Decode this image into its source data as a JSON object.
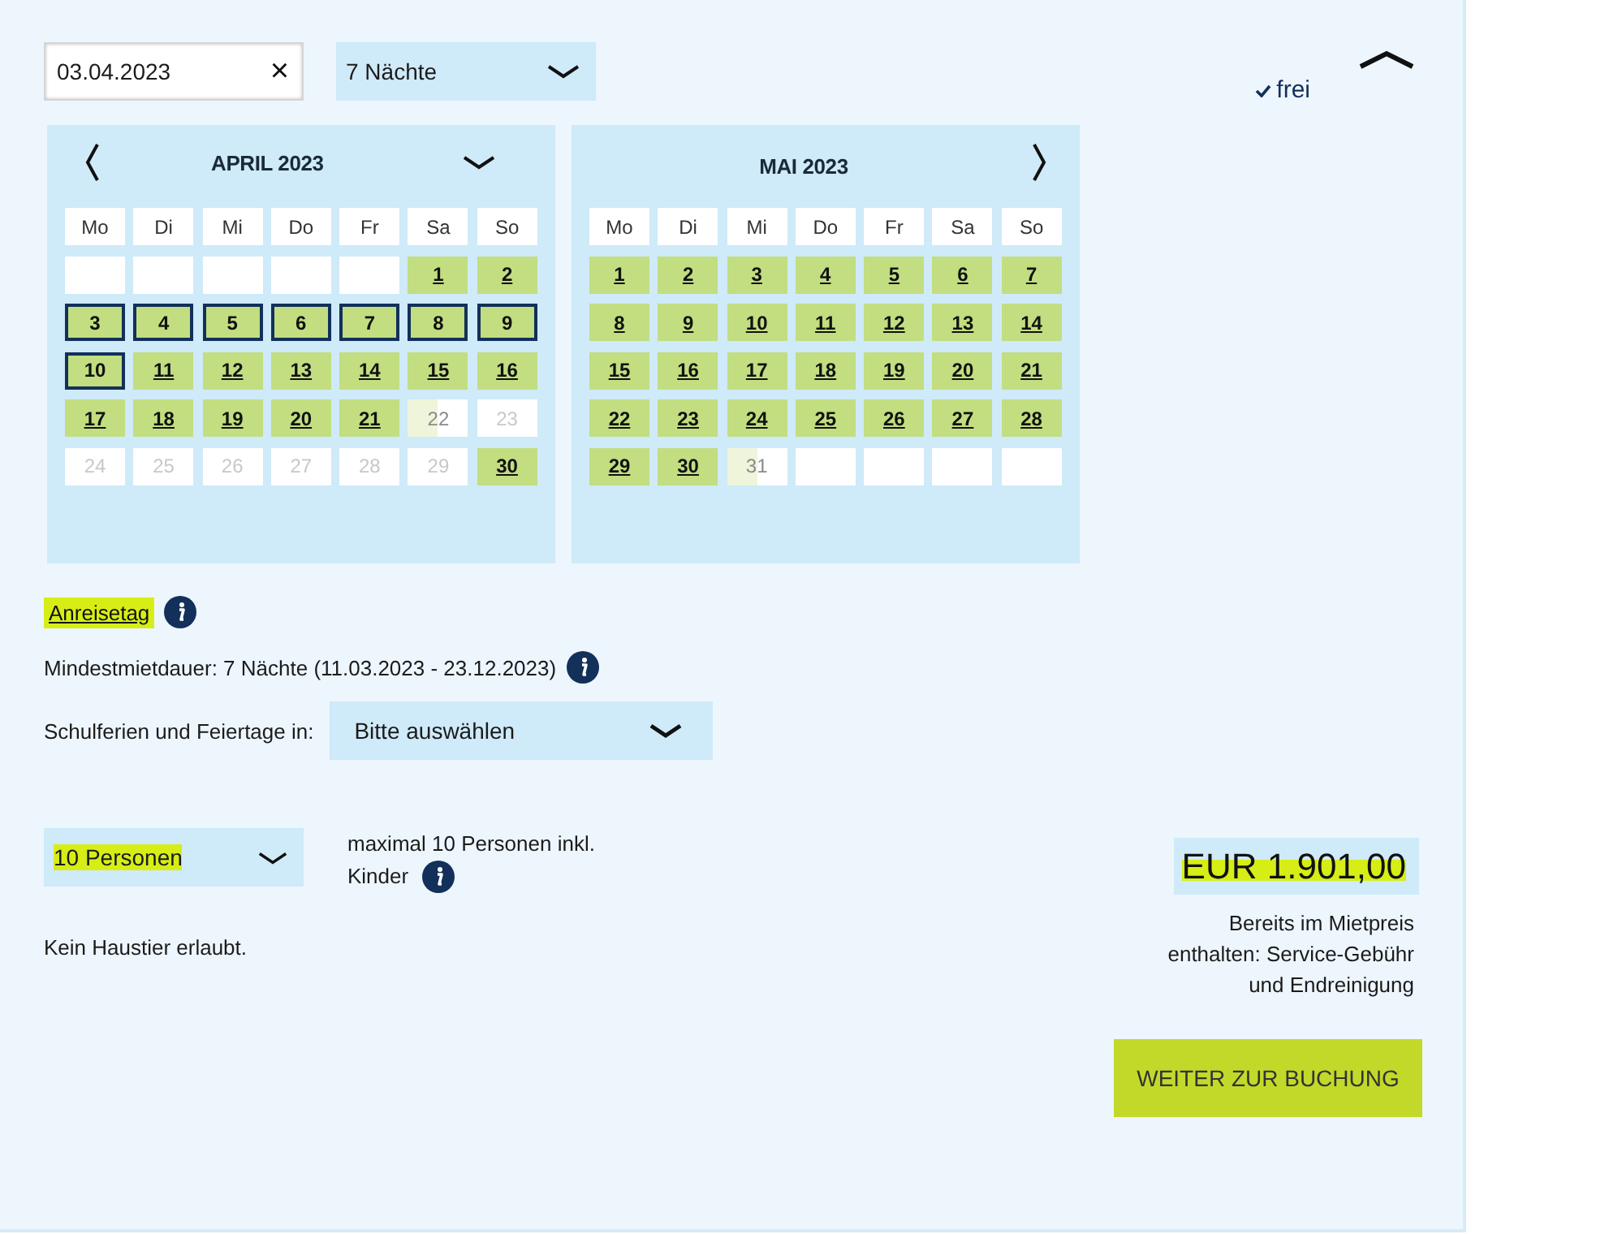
{
  "date_field": {
    "value": "03.04.2023",
    "clear": "×"
  },
  "nights_select": {
    "value": "7 Nächte"
  },
  "availability": {
    "text": "frei"
  },
  "calendars": [
    {
      "title": "APRIL 2023",
      "prev_button": true,
      "next_button": false,
      "month_menu": true,
      "weekdays": [
        "Mo",
        "Di",
        "Mi",
        "Do",
        "Fr",
        "Sa",
        "So"
      ],
      "days": [
        {
          "kind": "blank",
          "selected": false
        },
        {
          "kind": "blank",
          "selected": false
        },
        {
          "kind": "blank",
          "selected": false
        },
        {
          "kind": "blank",
          "selected": false
        },
        {
          "kind": "blank",
          "selected": false
        },
        {
          "day": "1",
          "kind": "available",
          "selected": false
        },
        {
          "day": "2",
          "kind": "available",
          "selected": false
        },
        {
          "day": "3",
          "kind": "available",
          "selected": true
        },
        {
          "day": "4",
          "kind": "available",
          "selected": true
        },
        {
          "day": "5",
          "kind": "available",
          "selected": true
        },
        {
          "day": "6",
          "kind": "available",
          "selected": true
        },
        {
          "day": "7",
          "kind": "available",
          "selected": true
        },
        {
          "day": "8",
          "kind": "available",
          "selected": true
        },
        {
          "day": "9",
          "kind": "available",
          "selected": true
        },
        {
          "day": "10",
          "kind": "available",
          "selected": true
        },
        {
          "day": "11",
          "kind": "available",
          "selected": false
        },
        {
          "day": "12",
          "kind": "available",
          "selected": false
        },
        {
          "day": "13",
          "kind": "available",
          "selected": false
        },
        {
          "day": "14",
          "kind": "available",
          "selected": false
        },
        {
          "day": "15",
          "kind": "available",
          "selected": false
        },
        {
          "day": "16",
          "kind": "available",
          "selected": false
        },
        {
          "day": "17",
          "kind": "available",
          "selected": false
        },
        {
          "day": "18",
          "kind": "available",
          "selected": false
        },
        {
          "day": "19",
          "kind": "available",
          "selected": false
        },
        {
          "day": "20",
          "kind": "available",
          "selected": false
        },
        {
          "day": "21",
          "kind": "available",
          "selected": false
        },
        {
          "day": "22",
          "kind": "partial",
          "selected": false
        },
        {
          "day": "23",
          "kind": "unavailable",
          "selected": false
        },
        {
          "day": "24",
          "kind": "unavailable",
          "selected": false
        },
        {
          "day": "25",
          "kind": "unavailable",
          "selected": false
        },
        {
          "day": "26",
          "kind": "unavailable",
          "selected": false
        },
        {
          "day": "27",
          "kind": "unavailable",
          "selected": false
        },
        {
          "day": "28",
          "kind": "unavailable",
          "selected": false
        },
        {
          "day": "29",
          "kind": "unavailable",
          "selected": false
        },
        {
          "day": "30",
          "kind": "available",
          "selected": false
        }
      ]
    },
    {
      "title": "MAI 2023",
      "prev_button": false,
      "next_button": true,
      "month_menu": false,
      "weekdays": [
        "Mo",
        "Di",
        "Mi",
        "Do",
        "Fr",
        "Sa",
        "So"
      ],
      "days": [
        {
          "day": "1",
          "kind": "available",
          "selected": false
        },
        {
          "day": "2",
          "kind": "available",
          "selected": false
        },
        {
          "day": "3",
          "kind": "available",
          "selected": false
        },
        {
          "day": "4",
          "kind": "available",
          "selected": false
        },
        {
          "day": "5",
          "kind": "available",
          "selected": false
        },
        {
          "day": "6",
          "kind": "available",
          "selected": false
        },
        {
          "day": "7",
          "kind": "available",
          "selected": false
        },
        {
          "day": "8",
          "kind": "available",
          "selected": false
        },
        {
          "day": "9",
          "kind": "available",
          "selected": false
        },
        {
          "day": "10",
          "kind": "available",
          "selected": false
        },
        {
          "day": "11",
          "kind": "available",
          "selected": false
        },
        {
          "day": "12",
          "kind": "available",
          "selected": false
        },
        {
          "day": "13",
          "kind": "available",
          "selected": false
        },
        {
          "day": "14",
          "kind": "available",
          "selected": false
        },
        {
          "day": "15",
          "kind": "available",
          "selected": false
        },
        {
          "day": "16",
          "kind": "available",
          "selected": false
        },
        {
          "day": "17",
          "kind": "available",
          "selected": false
        },
        {
          "day": "18",
          "kind": "available",
          "selected": false
        },
        {
          "day": "19",
          "kind": "available",
          "selected": false
        },
        {
          "day": "20",
          "kind": "available",
          "selected": false
        },
        {
          "day": "21",
          "kind": "available",
          "selected": false
        },
        {
          "day": "22",
          "kind": "available",
          "selected": false
        },
        {
          "day": "23",
          "kind": "available",
          "selected": false
        },
        {
          "day": "24",
          "kind": "available",
          "selected": false
        },
        {
          "day": "25",
          "kind": "available",
          "selected": false
        },
        {
          "day": "26",
          "kind": "available",
          "selected": false
        },
        {
          "day": "27",
          "kind": "available",
          "selected": false
        },
        {
          "day": "28",
          "kind": "available",
          "selected": false
        },
        {
          "day": "29",
          "kind": "available",
          "selected": false
        },
        {
          "day": "30",
          "kind": "available",
          "selected": false
        },
        {
          "day": "31",
          "kind": "partial",
          "selected": false
        },
        {
          "kind": "blank",
          "selected": false
        },
        {
          "kind": "blank",
          "selected": false
        },
        {
          "kind": "blank",
          "selected": false
        },
        {
          "kind": "blank",
          "selected": false
        }
      ]
    }
  ],
  "arrival_day": {
    "label": "Anreisetag",
    "highlighted": true
  },
  "minimum_stay": {
    "text": "Mindestmietdauer: 7 Nächte (11.03.2023 - 23.12.2023)"
  },
  "holidays": {
    "label": "Schulferien und Feiertage in:",
    "select": "Bitte auswählen"
  },
  "persons": {
    "value": "10 Personen",
    "highlighted": true,
    "note_lines": [
      "maximal 10 Personen inkl.",
      "Kinder"
    ]
  },
  "pets": "Kein Haustier erlaubt.",
  "price": {
    "amount": "EUR 1.901,00",
    "highlighted": true,
    "note": "Bereits im Mietpreis enthalten: Service-Gebühr und Endreinigung"
  },
  "booking_button": "WEITER ZUR BUCHUNG"
}
